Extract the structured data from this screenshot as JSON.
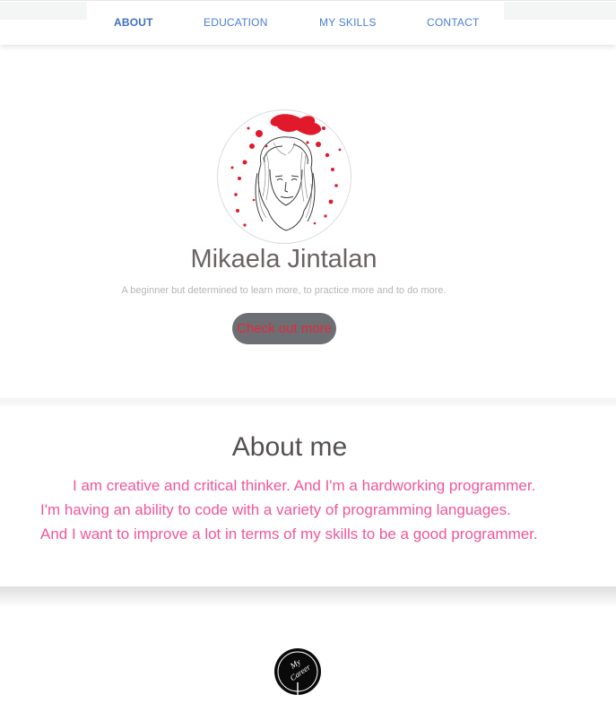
{
  "nav": {
    "items": [
      {
        "label": "ABOUT"
      },
      {
        "label": "EDUCATION"
      },
      {
        "label": "MY SKILLS"
      },
      {
        "label": "CONTACT"
      }
    ],
    "active": "ABOUT",
    "link_color": "#4a7fd4"
  },
  "hero": {
    "name": "Mikaela Jintalan",
    "tagline": "A beginner but determined to learn more, to practice more and to do more.",
    "button_label": "Check out more",
    "avatar_icon": "portrait-sketch-icon",
    "button_text_color": "#e8273a",
    "button_bg_color": "#6c6f73"
  },
  "about": {
    "title": "About me",
    "lines": [
      "I am creative and critical thinker. And I'm a hardworking programmer.",
      "I'm having an ability to code with a variety of programming languages.",
      "And I want to improve a lot in terms of my skills to be a good programmer."
    ],
    "text_color": "#f0569a"
  },
  "footer": {
    "logo_text_line1": "My",
    "logo_text_line2": "Career",
    "logo_icon": "my-career-logo-icon"
  }
}
